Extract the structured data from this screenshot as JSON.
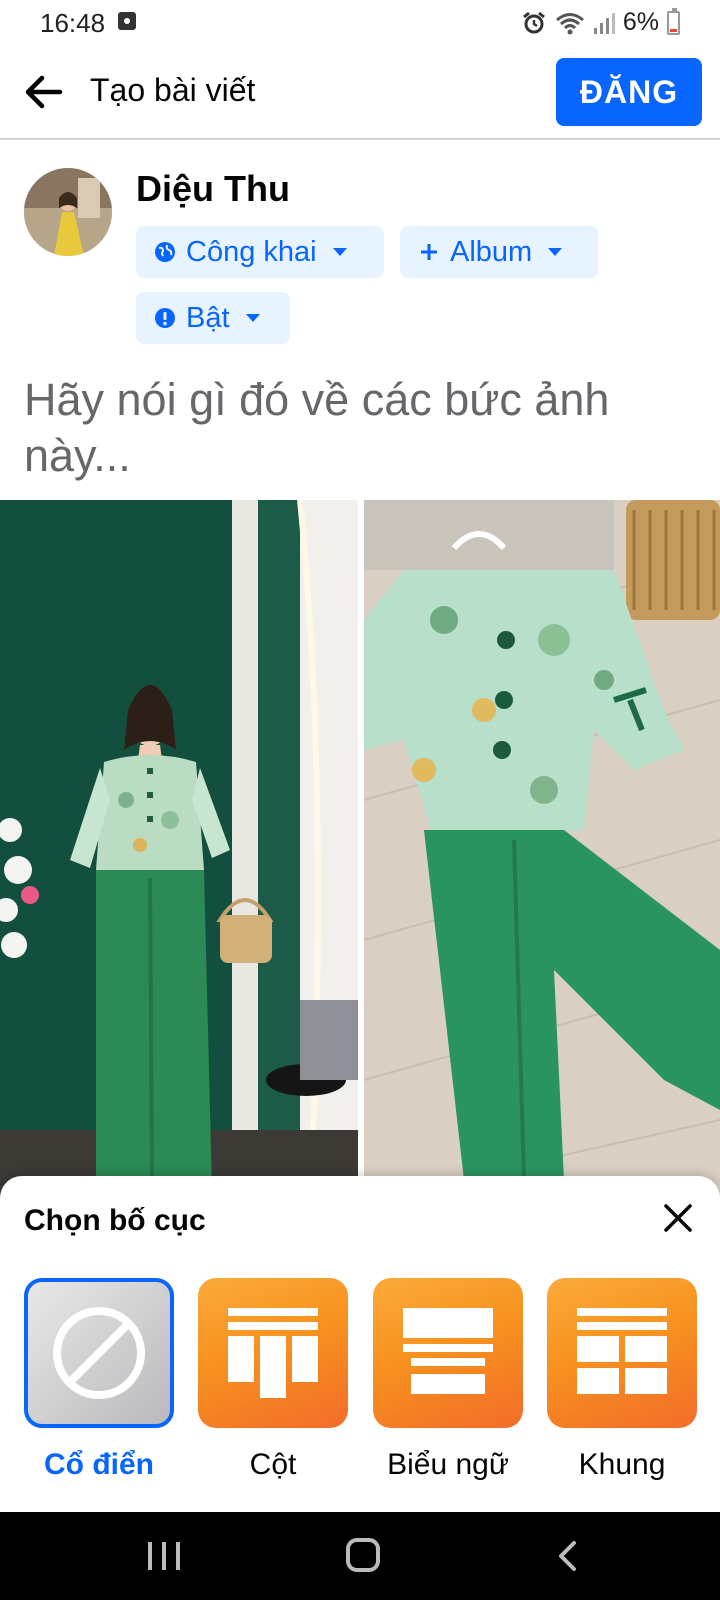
{
  "status_bar": {
    "time": "16:48",
    "battery": "6%"
  },
  "header": {
    "title": "Tạo bài viết",
    "post_button": "ĐĂNG"
  },
  "user": {
    "name": "Diệu Thu"
  },
  "audience": {
    "privacy_label": "Công khai",
    "album_label": "Album",
    "toggle_label": "Bật"
  },
  "composer": {
    "placeholder": "Hãy nói gì đó về các bức ảnh này..."
  },
  "layout_sheet": {
    "title": "Chọn bố cục",
    "selected": "Cổ điển",
    "options": [
      {
        "label": "Cổ điển"
      },
      {
        "label": "Cột"
      },
      {
        "label": "Biểu ngữ"
      },
      {
        "label": "Khung"
      }
    ]
  },
  "colors": {
    "accent": "#0866ff",
    "chip_bg": "#e7f3ff",
    "tile_orange": "#f7921e"
  }
}
